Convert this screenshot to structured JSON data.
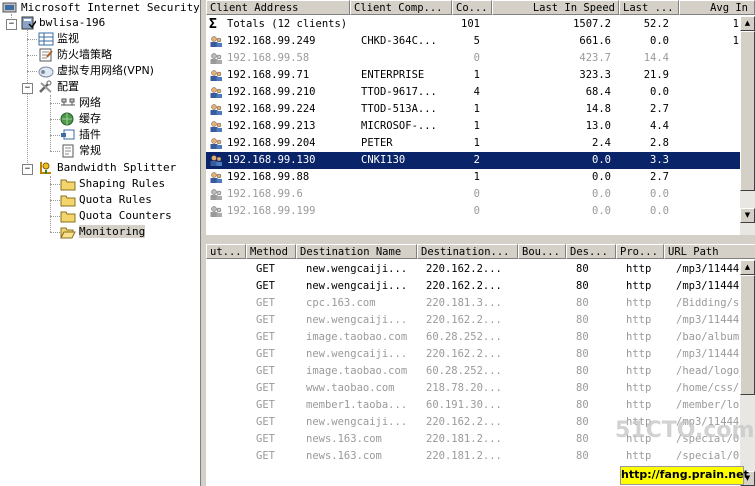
{
  "tree": {
    "root": "Microsoft Internet Security a",
    "server": "bwlisa-196",
    "items": [
      {
        "label": "监视",
        "icon": "monitor-icon"
      },
      {
        "label": "防火墙策略",
        "icon": "firewall-policy-icon"
      },
      {
        "label": "虚拟专用网络(VPN)",
        "icon": "vpn-icon"
      },
      {
        "label": "配置",
        "icon": "tools-icon"
      },
      {
        "label": "网络",
        "icon": "network-icon"
      },
      {
        "label": "缓存",
        "icon": "cache-icon"
      },
      {
        "label": "插件",
        "icon": "addin-icon"
      },
      {
        "label": "常规",
        "icon": "general-icon"
      },
      {
        "label": "Bandwidth Splitter",
        "icon": "bandwidth-splitter-icon"
      },
      {
        "label": "Shaping Rules",
        "icon": "folder-icon"
      },
      {
        "label": "Quota Rules",
        "icon": "folder-icon"
      },
      {
        "label": "Quota Counters",
        "icon": "folder-icon"
      },
      {
        "label": "Monitoring",
        "icon": "folder-open-icon"
      }
    ]
  },
  "clients": {
    "columns": [
      "Client Address",
      "Client Comp...",
      "Co...",
      "Last In Speed",
      "Last ...",
      "Avg In"
    ],
    "totals": {
      "label": "Totals (12 clients)",
      "co": "101",
      "speed": "1507.2",
      "last": "52.2",
      "avg": "1"
    },
    "rows": [
      {
        "addr": "192.168.99.249",
        "comp": "CHKD-364C...",
        "co": "5",
        "speed": "661.6",
        "last": "0.0",
        "avg": "1",
        "active": true
      },
      {
        "addr": "192.168.99.58",
        "comp": "",
        "co": "0",
        "speed": "423.7",
        "last": "14.4",
        "avg": "",
        "active": false
      },
      {
        "addr": "192.168.99.71",
        "comp": "ENTERPRISE",
        "co": "1",
        "speed": "323.3",
        "last": "21.9",
        "avg": "",
        "active": true
      },
      {
        "addr": "192.168.99.210",
        "comp": "TTOD-9617...",
        "co": "4",
        "speed": "68.4",
        "last": "0.0",
        "avg": "",
        "active": true
      },
      {
        "addr": "192.168.99.224",
        "comp": "TTOD-513A...",
        "co": "1",
        "speed": "14.8",
        "last": "2.7",
        "avg": "",
        "active": true
      },
      {
        "addr": "192.168.99.213",
        "comp": "MICROSOF-...",
        "co": "1",
        "speed": "13.0",
        "last": "4.4",
        "avg": "",
        "active": true
      },
      {
        "addr": "192.168.99.204",
        "comp": "PETER",
        "co": "1",
        "speed": "2.4",
        "last": "2.8",
        "avg": "",
        "active": true
      },
      {
        "addr": "192.168.99.130",
        "comp": "CNKI130",
        "co": "2",
        "speed": "0.0",
        "last": "3.3",
        "avg": "",
        "active": true,
        "selected": true
      },
      {
        "addr": "192.168.99.88",
        "comp": "",
        "co": "1",
        "speed": "0.0",
        "last": "2.7",
        "avg": "",
        "active": true
      },
      {
        "addr": "192.168.99.6",
        "comp": "",
        "co": "0",
        "speed": "0.0",
        "last": "0.0",
        "avg": "",
        "active": false
      },
      {
        "addr": "192.168.99.199",
        "comp": "",
        "co": "0",
        "speed": "0.0",
        "last": "0.0",
        "avg": "",
        "active": false
      }
    ]
  },
  "connections": {
    "columns": [
      "ut...",
      "Method",
      "Destination Name",
      "Destination...",
      "Bou...",
      "Des...",
      "Pro...",
      "URL Path"
    ],
    "rows": [
      {
        "method": "GET",
        "name": "new.wengcaiji...",
        "ip": "220.162.2...",
        "port": "80",
        "proto": "http",
        "path": "/mp3/114446",
        "active": true
      },
      {
        "method": "GET",
        "name": "new.wengcaiji...",
        "ip": "220.162.2...",
        "port": "80",
        "proto": "http",
        "path": "/mp3/114446",
        "active": true
      },
      {
        "method": "GET",
        "name": "cpc.163.com",
        "ip": "220.181.3...",
        "port": "80",
        "proto": "http",
        "path": "/Bidding/se",
        "active": false
      },
      {
        "method": "GET",
        "name": "new.wengcaiji...",
        "ip": "220.162.2...",
        "port": "80",
        "proto": "http",
        "path": "/mp3/114446",
        "active": false
      },
      {
        "method": "GET",
        "name": "image.taobao.com",
        "ip": "60.28.252...",
        "port": "80",
        "proto": "http",
        "path": "/bao/album/",
        "active": false
      },
      {
        "method": "GET",
        "name": "new.wengcaiji...",
        "ip": "220.162.2...",
        "port": "80",
        "proto": "http",
        "path": "/mp3/114446",
        "active": false
      },
      {
        "method": "GET",
        "name": "image.taobao.com",
        "ip": "60.28.252...",
        "port": "80",
        "proto": "http",
        "path": "/head/logo_",
        "active": false
      },
      {
        "method": "GET",
        "name": "www.taobao.com",
        "ip": "218.78.20...",
        "port": "80",
        "proto": "http",
        "path": "/home/css/g",
        "active": false
      },
      {
        "method": "GET",
        "name": "member1.taoba...",
        "ip": "60.191.30...",
        "port": "80",
        "proto": "http",
        "path": "/member/log",
        "active": false
      },
      {
        "method": "GET",
        "name": "new.wengcaiji...",
        "ip": "220.162.2...",
        "port": "80",
        "proto": "http",
        "path": "/mp3/11444(",
        "active": false
      },
      {
        "method": "GET",
        "name": "news.163.com",
        "ip": "220.181.2...",
        "port": "80",
        "proto": "http",
        "path": "/special/00",
        "active": false
      },
      {
        "method": "GET",
        "name": "news.163.com",
        "ip": "220.181.2...",
        "port": "80",
        "proto": "http",
        "path": "/special/00",
        "active": false
      }
    ]
  },
  "watermark": {
    "url": "http://fang.prain.net",
    "logo": "51CTO.com"
  }
}
